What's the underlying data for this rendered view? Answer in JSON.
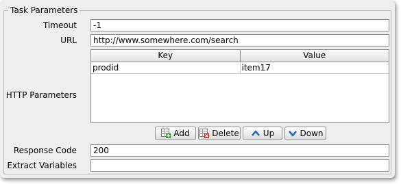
{
  "group": {
    "title": "Task Parameters"
  },
  "fields": {
    "timeout": {
      "label": "Timeout",
      "value": "-1"
    },
    "url": {
      "label": "URL",
      "value": "http://www.somewhere.com/search"
    },
    "http_params": {
      "label": "HTTP Parameters"
    },
    "response_code": {
      "label": "Response Code",
      "value": "200"
    },
    "extract_vars": {
      "label": "Extract Variables",
      "value": ""
    }
  },
  "table": {
    "columns": [
      "Key",
      "Value"
    ],
    "rows": [
      {
        "key": "prodid",
        "value": "item17"
      }
    ]
  },
  "buttons": {
    "add": {
      "label": "Add",
      "icon": "table-add-icon"
    },
    "delete": {
      "label": "Delete",
      "icon": "table-delete-icon"
    },
    "up": {
      "label": "Up",
      "icon": "arrow-up-icon"
    },
    "down": {
      "label": "Down",
      "icon": "arrow-down-icon"
    }
  },
  "colors": {
    "arrow_blue": "#2a66c8",
    "delete_red": "#cc2222",
    "add_green": "#2e9a2e"
  }
}
